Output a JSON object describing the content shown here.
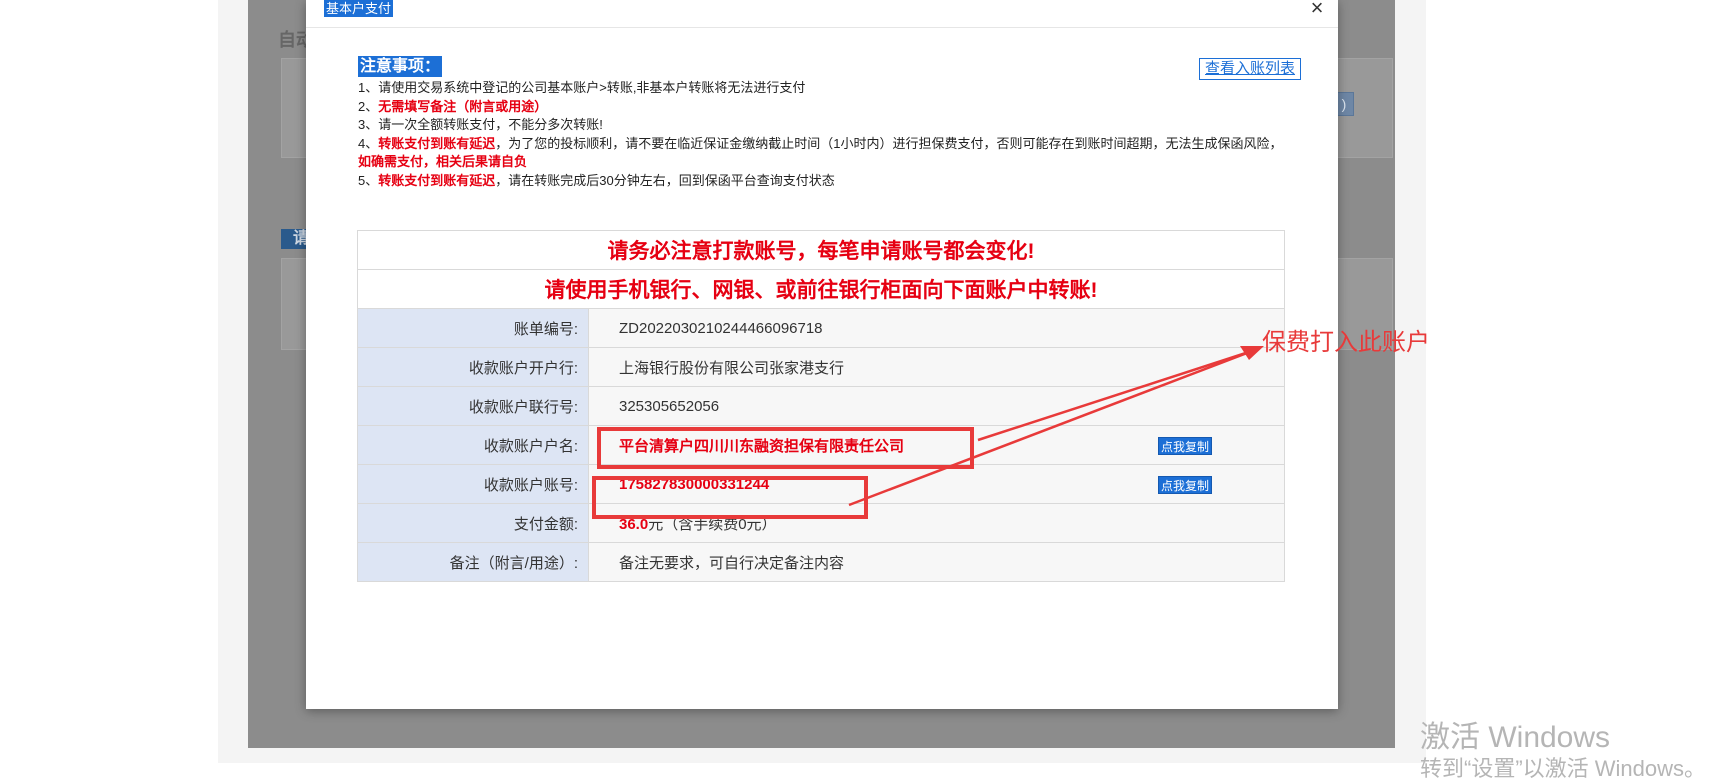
{
  "background": {
    "heading_1": "自动",
    "heading_2": "请",
    "sliver": ")"
  },
  "modal": {
    "title": "基本户支付",
    "close_icon": "close-icon",
    "view_list_button": "查看入账列表",
    "notes": {
      "title": "注意事项：",
      "line1": "1、请使用交易系统中登记的公司基本账户>转账,非基本户转账将无法进行支付",
      "line2_prefix": "2、",
      "line2_red": "无需填写备注（附言或用途）",
      "line3": "3、请一次全额转账支付，不能分多次转账!",
      "line4_prefix": "4、",
      "line4_red": "转账支付到账有延迟",
      "line4_text": "，为了您的投标顺利，请不要在临近保证金缴纳截止时间（1小时内）进行担保费支付，否则可能存在到账时间超期，无法生成保函风险，",
      "line4_red2": "如确需支付，相关后果请自负",
      "line5_prefix": "5、",
      "line5_red": "转账支付到账有延迟",
      "line5_text": "，请在转账完成后30分钟左右，回到保函平台查询支付状态"
    },
    "banner_1": "请务必注意打款账号，每笔申请账号都会变化!",
    "banner_2": "请使用手机银行、网银、或前往银行柜面向下面账户中转账!",
    "rows": [
      {
        "label": "账单编号:",
        "value": "ZD2022030210244466096718"
      },
      {
        "label": "收款账户开户行:",
        "value": "上海银行股份有限公司张家港支行"
      },
      {
        "label": "收款账户联行号:",
        "value": "325305652056"
      },
      {
        "label": "收款账户户名:",
        "value": "平台清算户四川川东融资担保有限责任公司",
        "copy": "点我复制"
      },
      {
        "label": "收款账户账号:",
        "value": "175827830000331244",
        "copy": "点我复制"
      },
      {
        "label": "支付金额:",
        "amount": "36.0",
        "unit": "元（含手续费0元）"
      },
      {
        "label": "备注（附言/用途）:",
        "value": "备注无要求，可自行决定备注内容"
      }
    ]
  },
  "annotation": {
    "label": "保费打入此账户",
    "color": "#e83a3a"
  },
  "watermark": {
    "line1": "激活 Windows",
    "line2": "转到“设置”以激活 Windows。"
  },
  "colors": {
    "accent_blue": "#1c6fd6",
    "alert_red": "#e60012",
    "label_bg": "#dde5f4"
  }
}
